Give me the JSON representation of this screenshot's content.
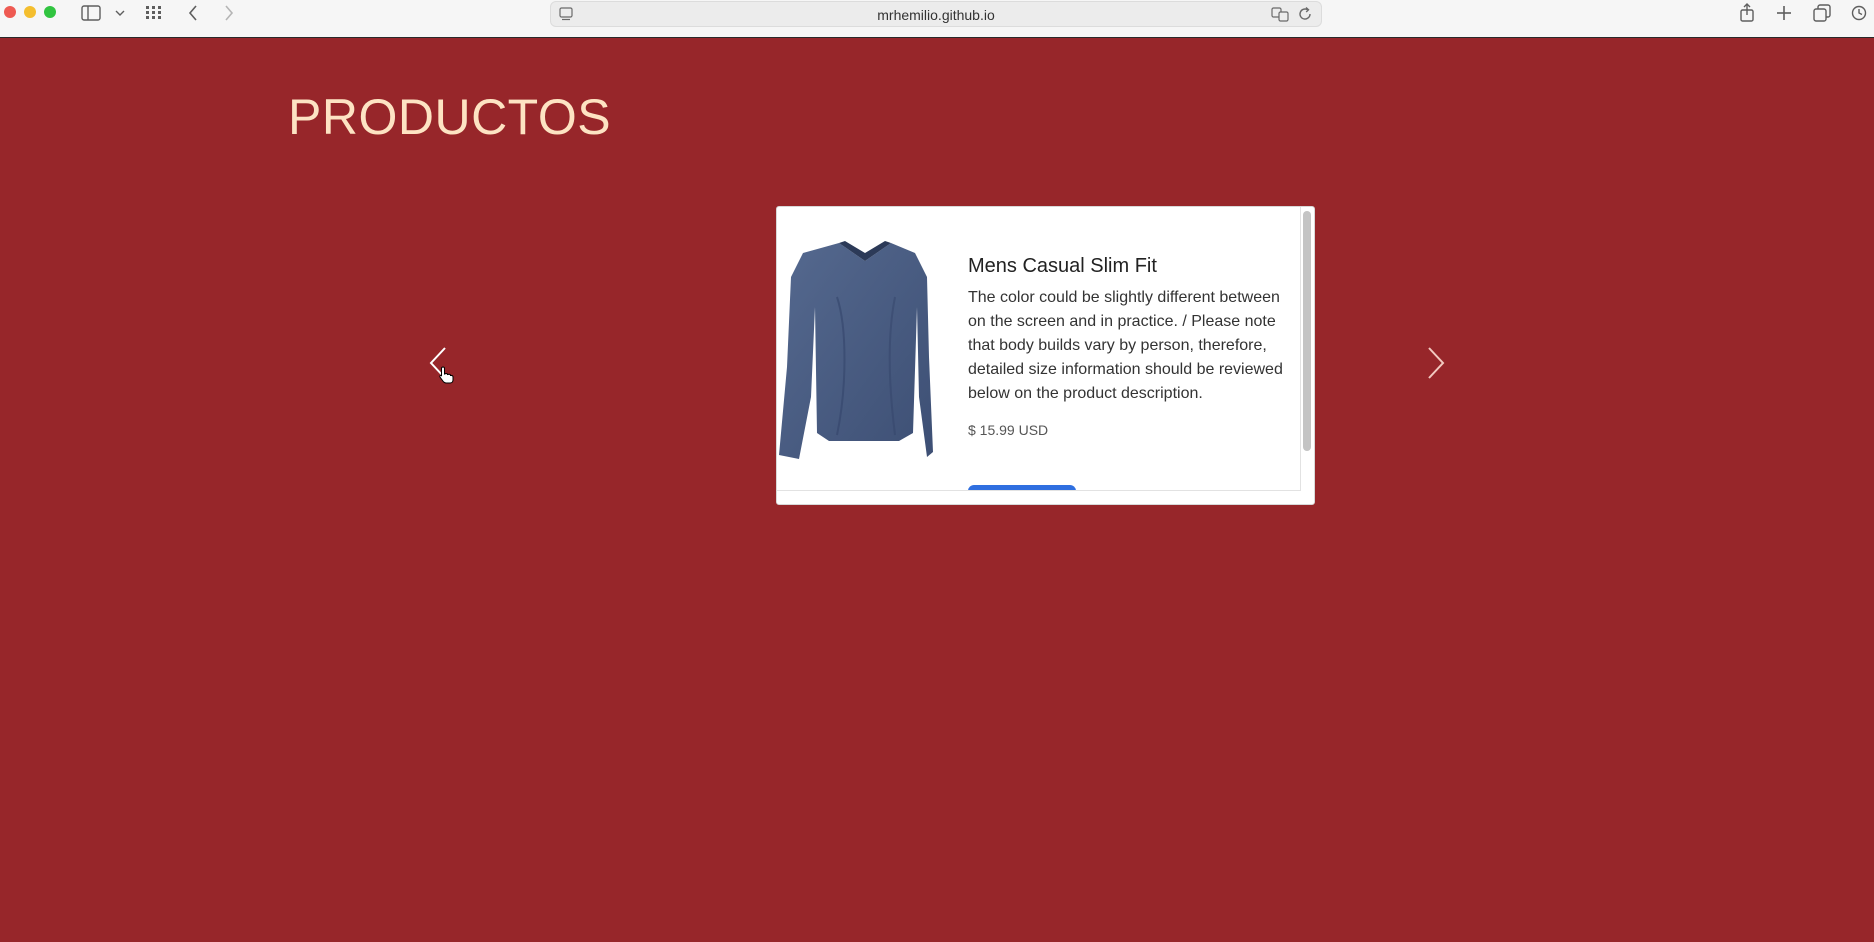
{
  "browser": {
    "url": "mrhemilio.github.io"
  },
  "page": {
    "title": "PRODUCTOS",
    "background": "#97262a",
    "title_color": "#fde3c3"
  },
  "carousel": {
    "prev_icon": "chevron-left-icon",
    "next_icon": "chevron-right-icon",
    "product": {
      "title": "Mens Casual Slim Fit",
      "description": "The color could be slightly different between on the screen and in practice. / Please note that body builds vary by person, therefore, detailed size information should be reviewed below on the product description.",
      "price": "$ 15.99 USD",
      "image": "long-sleeve-v-neck-shirt"
    }
  },
  "colors": {
    "button": "#2f6fe0"
  }
}
